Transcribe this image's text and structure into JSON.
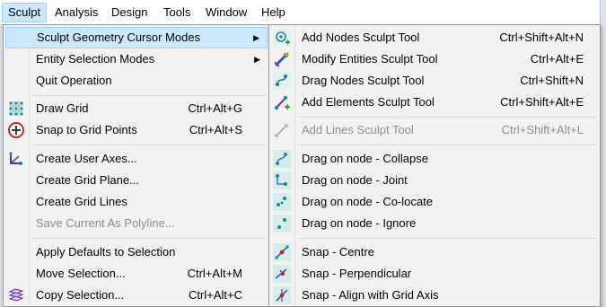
{
  "menubar": {
    "items": [
      {
        "label": "Sculpt"
      },
      {
        "label": "Analysis"
      },
      {
        "label": "Design"
      },
      {
        "label": "Tools"
      },
      {
        "label": "Window"
      },
      {
        "label": "Help"
      }
    ]
  },
  "sculpt_menu": {
    "items": [
      {
        "label": "Sculpt Geometry Cursor Modes",
        "has_submenu": true
      },
      {
        "label": "Entity Selection Modes",
        "has_submenu": true
      },
      {
        "label": "Quit Operation"
      },
      {
        "label": "Draw Grid",
        "shortcut": "Ctrl+Alt+G",
        "icon": "grid-icon"
      },
      {
        "label": "Snap to Grid Points",
        "shortcut": "Ctrl+Alt+S",
        "icon": "snap-grid-icon"
      },
      {
        "label": "Create User Axes...",
        "icon": "user-axes-icon"
      },
      {
        "label": "Create Grid Plane..."
      },
      {
        "label": "Create Grid Lines"
      },
      {
        "label": "Save Current As Polyline...",
        "disabled": true
      },
      {
        "label": "Apply Defaults to Selection"
      },
      {
        "label": "Move Selection...",
        "shortcut": "Ctrl+Alt+M"
      },
      {
        "label": "Copy Selection...",
        "shortcut": "Ctrl+Alt+C",
        "icon": "copy-selection-icon"
      }
    ]
  },
  "cursor_modes_menu": {
    "items": [
      {
        "label": "Add Nodes Sculpt Tool",
        "shortcut": "Ctrl+Shift+Alt+N",
        "icon": "add-nodes-icon"
      },
      {
        "label": "Modify Entities Sculpt Tool",
        "shortcut": "Ctrl+Alt+E",
        "icon": "modify-entities-icon"
      },
      {
        "label": "Drag Nodes Sculpt Tool",
        "shortcut": "Ctrl+Shift+N",
        "icon": "drag-nodes-icon"
      },
      {
        "label": "Add Elements Sculpt Tool",
        "shortcut": "Ctrl+Shift+Alt+E",
        "icon": "add-elements-icon"
      },
      {
        "label": "Add Lines Sculpt Tool",
        "shortcut": "Ctrl+Shift+Alt+L",
        "icon": "add-lines-icon",
        "disabled": true
      },
      {
        "label": "Drag on node - Collapse",
        "icon": "drag-collapse-icon"
      },
      {
        "label": "Drag on node - Joint",
        "icon": "drag-joint-icon"
      },
      {
        "label": "Drag on node - Co-locate",
        "icon": "drag-colocate-icon"
      },
      {
        "label": "Drag on node - Ignore",
        "icon": "drag-ignore-icon"
      },
      {
        "label": "Snap - Centre",
        "icon": "snap-centre-icon"
      },
      {
        "label": "Snap - Perpendicular",
        "icon": "snap-perpendicular-icon"
      },
      {
        "label": "Snap - Align with Grid Axis",
        "icon": "snap-align-icon"
      }
    ]
  },
  "colors": {
    "highlight": "#cce8ff",
    "highlight_border": "#99d1ff",
    "disabled_text": "#8d8d8d",
    "icon_teal": "#1a8a8a",
    "icon_blue": "#2b5fb4"
  }
}
